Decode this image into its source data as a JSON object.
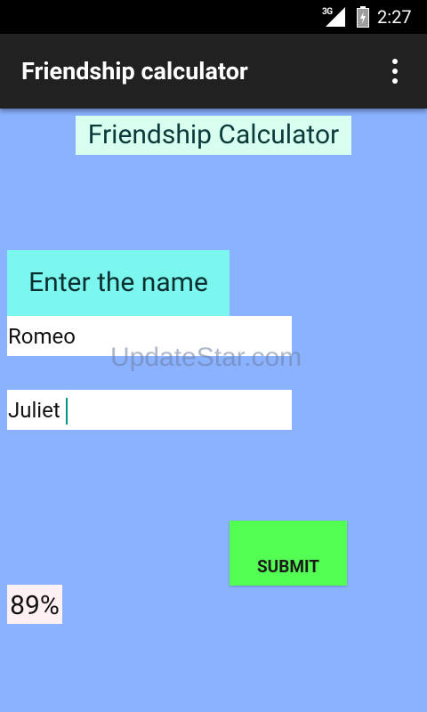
{
  "status_bar": {
    "network_type": "3G",
    "time": "2:27",
    "icons": [
      "signal-icon",
      "battery-charging-icon"
    ]
  },
  "action_bar": {
    "title": "Friendship calculator",
    "overflow_icon": "more-vert-icon"
  },
  "content": {
    "heading": "Friendship Calculator",
    "prompt": "Enter the name",
    "name1_value": "Romeo",
    "name2_value": "Juliet",
    "submit_label": "SUBMIT",
    "result": "89%",
    "watermark": "UpdateStar.com"
  },
  "colors": {
    "background": "#8bb2ff",
    "action_bar": "#212121",
    "heading_bg": "#d8ffef",
    "prompt_bg": "#7cf7ef",
    "submit_bg": "#52ff52",
    "result_bg": "#fff0f3",
    "caret": "#009688"
  }
}
